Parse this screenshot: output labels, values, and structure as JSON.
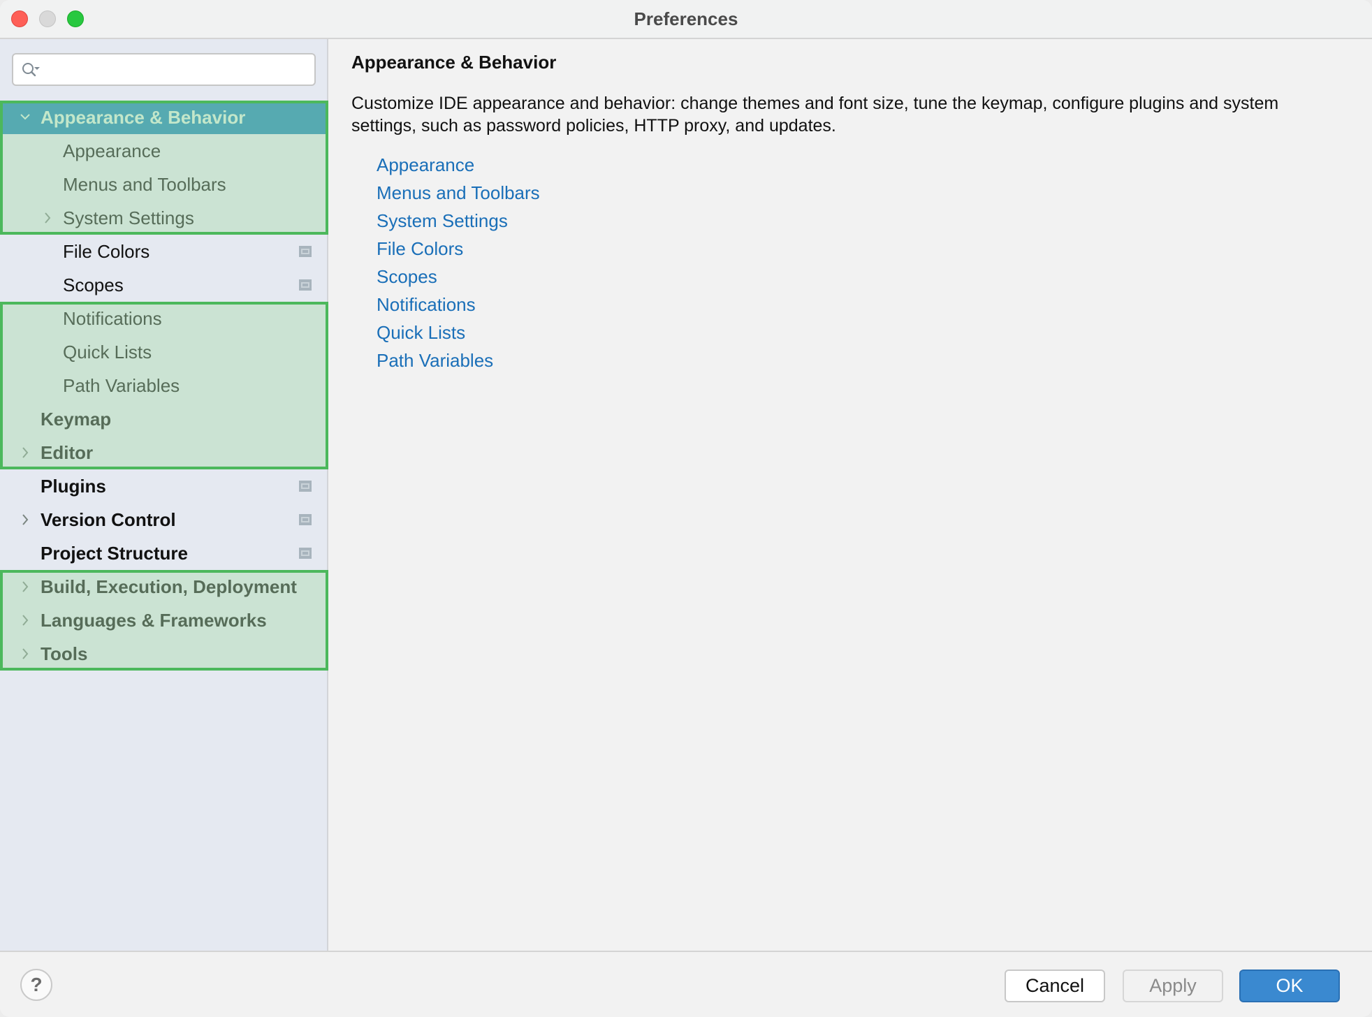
{
  "window": {
    "title": "Preferences"
  },
  "sidebar": {
    "search": {
      "value": "",
      "placeholder": ""
    },
    "items": [
      {
        "label": "Appearance & Behavior",
        "level": 0,
        "expandable": true,
        "expanded": true,
        "selected": true,
        "project_scope": false
      },
      {
        "label": "Appearance",
        "level": 1,
        "expandable": false,
        "selected": false,
        "project_scope": false
      },
      {
        "label": "Menus and Toolbars",
        "level": 1,
        "expandable": false,
        "selected": false,
        "project_scope": false
      },
      {
        "label": "System Settings",
        "level": 1,
        "expandable": true,
        "expanded": false,
        "selected": false,
        "project_scope": false
      },
      {
        "label": "File Colors",
        "level": 1,
        "expandable": false,
        "selected": false,
        "project_scope": true
      },
      {
        "label": "Scopes",
        "level": 1,
        "expandable": false,
        "selected": false,
        "project_scope": true
      },
      {
        "label": "Notifications",
        "level": 1,
        "expandable": false,
        "selected": false,
        "project_scope": false
      },
      {
        "label": "Quick Lists",
        "level": 1,
        "expandable": false,
        "selected": false,
        "project_scope": false
      },
      {
        "label": "Path Variables",
        "level": 1,
        "expandable": false,
        "selected": false,
        "project_scope": false
      },
      {
        "label": "Keymap",
        "level": 0,
        "expandable": false,
        "selected": false,
        "project_scope": false
      },
      {
        "label": "Editor",
        "level": 0,
        "expandable": true,
        "expanded": false,
        "selected": false,
        "project_scope": false
      },
      {
        "label": "Plugins",
        "level": 0,
        "expandable": false,
        "selected": false,
        "project_scope": true
      },
      {
        "label": "Version Control",
        "level": 0,
        "expandable": true,
        "expanded": false,
        "selected": false,
        "project_scope": true
      },
      {
        "label": "Project Structure",
        "level": 0,
        "expandable": false,
        "selected": false,
        "project_scope": true
      },
      {
        "label": "Build, Execution, Deployment",
        "level": 0,
        "expandable": true,
        "expanded": false,
        "selected": false,
        "project_scope": false
      },
      {
        "label": "Languages & Frameworks",
        "level": 0,
        "expandable": true,
        "expanded": false,
        "selected": false,
        "project_scope": false
      },
      {
        "label": "Tools",
        "level": 0,
        "expandable": true,
        "expanded": false,
        "selected": false,
        "project_scope": false
      }
    ],
    "highlight_groups": [
      {
        "from_item": 0,
        "to_item": 3
      },
      {
        "from_item": 6,
        "to_item": 10
      },
      {
        "from_item": 14,
        "to_item": 16
      }
    ]
  },
  "main": {
    "title": "Appearance & Behavior",
    "description": "Customize IDE appearance and behavior: change themes and font size, tune the keymap, configure plugins and system settings, such as password policies, HTTP proxy, and updates.",
    "links": [
      "Appearance",
      "Menus and Toolbars",
      "System Settings",
      "File Colors",
      "Scopes",
      "Notifications",
      "Quick Lists",
      "Path Variables"
    ]
  },
  "footer": {
    "help_label": "?",
    "cancel_label": "Cancel",
    "apply_label": "Apply",
    "ok_label": "OK",
    "apply_enabled": false
  },
  "colors": {
    "selection": "#1282b2",
    "highlight_border": "#4cb85c",
    "link": "#1a6fb8",
    "ok_button": "#3a89d0"
  }
}
